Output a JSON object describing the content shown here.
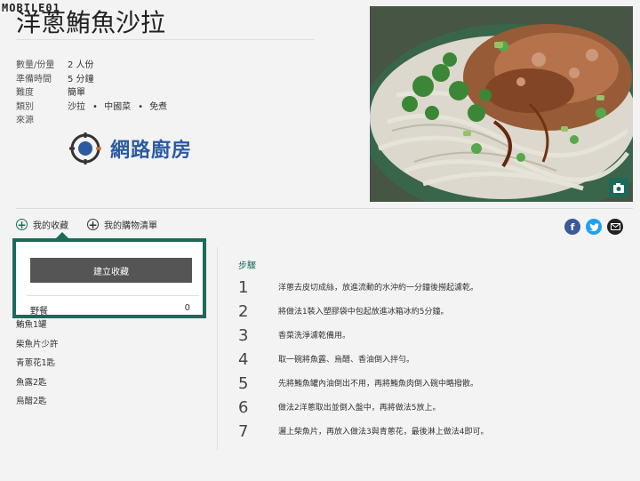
{
  "watermark": "MOBILE01",
  "recipe": {
    "title": "洋蔥鮪魚沙拉",
    "meta": [
      {
        "label": "數量/份量",
        "value": "2 人份"
      },
      {
        "label": "準備時間",
        "value": "5 分鐘"
      },
      {
        "label": "難度",
        "value": "簡單"
      }
    ],
    "category_label": "類別",
    "categories": [
      "沙拉",
      "中國菜",
      "免煮"
    ],
    "source_label": "來源",
    "source_name": "網路廚房"
  },
  "actions": {
    "favorites": "我的收藏",
    "shopping": "我的購物清單"
  },
  "popup": {
    "create_label": "建立收藏",
    "list_name": "野餐",
    "list_count": "0"
  },
  "ingredients": [
    "鮪魚1罐",
    "柴魚片少許",
    "青蔥花1匙",
    "魚露2匙",
    "烏醋2匙"
  ],
  "steps_title": "步驟",
  "steps": [
    {
      "num": "1",
      "text": "洋蔥去皮切成絲，放進流動的水沖約一分鐘後撈起濾乾。"
    },
    {
      "num": "2",
      "text": "將做法1裝入塑膠袋中包起放進冰箱冰約5分鐘。"
    },
    {
      "num": "3",
      "text": "香菜洗淨濾乾備用。"
    },
    {
      "num": "4",
      "text": "取一碗將魚露、烏醋、香油倒入拌勻。"
    },
    {
      "num": "5",
      "text": "先將鮪魚罐內油倒出不用，再將鮪魚肉倒入碗中略撥散。"
    },
    {
      "num": "6",
      "text": "做法2洋蔥取出並倒入盤中，再將做法5放上。"
    },
    {
      "num": "7",
      "text": "灑上柴魚片，再放入做法3與青蔥花，最後淋上做法4即可。"
    }
  ],
  "colors": {
    "accent": "#1a6b5a",
    "facebook": "#3b5998",
    "twitter": "#1da1f2"
  }
}
